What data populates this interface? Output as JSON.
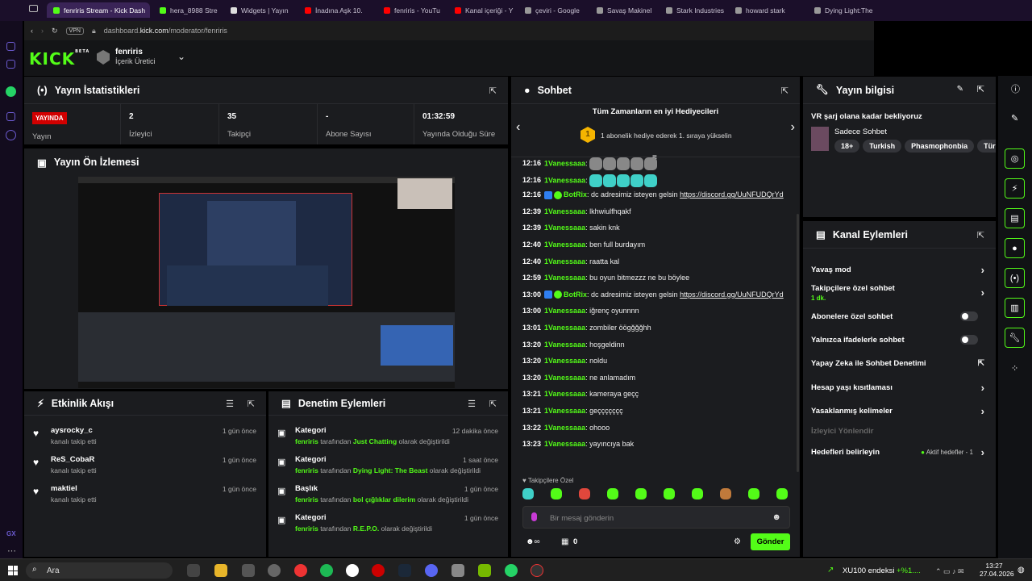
{
  "browser": {
    "tabs": [
      {
        "label": "fenriris Stream - Kick Dash",
        "color": "#53fc18",
        "active": true
      },
      {
        "label": "hera_8988 Stre",
        "color": "#53fc18"
      },
      {
        "label": "Widgets | Yayın",
        "color": "#dddddd"
      },
      {
        "label": "İnadına Aşk 10.",
        "color": "#ff0000"
      },
      {
        "label": "fenriris - YouTu",
        "color": "#ff0000"
      },
      {
        "label": "Kanal içeriği - Y",
        "color": "#ff0000"
      },
      {
        "label": "çeviri - Google",
        "color": "#999999"
      },
      {
        "label": "Savaş Makinel",
        "color": "#999999"
      },
      {
        "label": "Stark Industries",
        "color": "#999999"
      },
      {
        "label": "howard stark",
        "color": "#999999"
      },
      {
        "label": "Dying Light:The",
        "color": "#999999"
      }
    ],
    "vpn_label": "VPN",
    "url_prefix": "dashboard.",
    "url_domain": "kick.com",
    "url_path": "/moderator/fenriris"
  },
  "header": {
    "logo": "KICK",
    "logo_badge": "BETA",
    "channel_name": "fenriris",
    "channel_role": "İçerik Üretici"
  },
  "stats": {
    "title": "Yayın İstatistikleri",
    "live_badge": "YAYINDA",
    "items": [
      {
        "value": "",
        "label": "Yayın"
      },
      {
        "value": "2",
        "label": "İzleyici"
      },
      {
        "value": "35",
        "label": "Takipçi"
      },
      {
        "value": "-",
        "label": "Abone Sayısı"
      },
      {
        "value": "01:32:59",
        "label": "Yayında Olduğu Süre"
      }
    ]
  },
  "preview": {
    "title": "Yayın Ön İzlemesi"
  },
  "activity": {
    "title": "Etkinlik Akışı",
    "items": [
      {
        "user": "aysrocky_c",
        "action": "kanalı takip etti",
        "time": "1 gün önce"
      },
      {
        "user": "ReS_CobaR",
        "action": "kanalı takip etti",
        "time": "1 gün önce"
      },
      {
        "user": "maktiel",
        "action": "kanalı takip etti",
        "time": "1 gün önce"
      }
    ]
  },
  "moderation": {
    "title": "Denetim Eylemleri",
    "items": [
      {
        "type": "Kategori",
        "user": "fenriris",
        "mid": " tarafından ",
        "value": "Just Chatting",
        "end": " olarak değiştirildi",
        "time": "12 dakika önce"
      },
      {
        "type": "Kategori",
        "user": "fenriris",
        "mid": " tarafından ",
        "value": "Dying Light: The Beast",
        "end": " olarak değiştirildi",
        "time": "1 saat önce"
      },
      {
        "type": "Başlık",
        "user": "fenriris",
        "mid": " tarafından ",
        "value": "bol çığlıklar dilerim",
        "end": " olarak değiştirildi",
        "time": "1 gün önce"
      },
      {
        "type": "Kategori",
        "user": "fenriris",
        "mid": " tarafından ",
        "value": "R.E.P.O.",
        "end": " olarak değiştirildi",
        "time": "1 gün önce"
      }
    ]
  },
  "chat": {
    "title": "Sohbet",
    "gifters_title": "Tüm Zamanların en iyi Hediyecileri",
    "gifters_rank": "1",
    "gifters_sub": "1 abonelik hediye ederek 1. sıraya yükselin",
    "messages": [
      {
        "time": "12:16",
        "user": "1Vanessaaa",
        "text": "",
        "emotes": "ggggg"
      },
      {
        "time": "12:16",
        "user": "1Vanessaaa",
        "text": "",
        "emotes": "ccccc"
      },
      {
        "time": "12:16",
        "user": "BotRix",
        "text": "dc adresimiz isteyen gelsin ",
        "link": "https://discord.gg/UuNFUDQrYd",
        "bot": true
      },
      {
        "time": "12:39",
        "user": "1Vanessaaa",
        "text": "lkhwiulfhqakf"
      },
      {
        "time": "12:39",
        "user": "1Vanessaaa",
        "text": "sakin knk"
      },
      {
        "time": "12:40",
        "user": "1Vanessaaa",
        "text": "ben full burdayım"
      },
      {
        "time": "12:40",
        "user": "1Vanessaaa",
        "text": "raatta kal"
      },
      {
        "time": "12:59",
        "user": "1Vanessaaa",
        "text": "bu oyun bitmezzz ne bu böylee"
      },
      {
        "time": "13:00",
        "user": "BotRix",
        "text": "dc adresimiz isteyen gelsin ",
        "link": "https://discord.gg/UuNFUDQrYd",
        "bot": true
      },
      {
        "time": "13:00",
        "user": "1Vanessaaa",
        "text": "iğrenç oyunnnn"
      },
      {
        "time": "13:01",
        "user": "1Vanessaaa",
        "text": "zombiler öögğğğhh"
      },
      {
        "time": "13:20",
        "user": "1Vanessaaa",
        "text": "hoşgeldinn"
      },
      {
        "time": "13:20",
        "user": "1Vanessaaa",
        "text": "noldu"
      },
      {
        "time": "13:20",
        "user": "1Vanessaaa",
        "text": "ne anlamadım"
      },
      {
        "time": "13:21",
        "user": "1Vanessaaa",
        "text": "kameraya geçç"
      },
      {
        "time": "13:21",
        "user": "1Vanessaaa",
        "text": "geççççççç"
      },
      {
        "time": "13:22",
        "user": "1Vanessaaa",
        "text": "ohooo"
      },
      {
        "time": "13:23",
        "user": "1Vanessaaa",
        "text": "yayıncıya bak"
      }
    ],
    "followers_only_label": "Takipçilere Özel",
    "input_placeholder": "Bir mesaj gönderin",
    "counter_value": "0",
    "send_label": "Gönder",
    "emote_colors": [
      "#3fd0c8",
      "#53fc18",
      "#e0473c",
      "#53fc18",
      "#53fc18",
      "#53fc18",
      "#53fc18",
      "#c07a3b",
      "#53fc18",
      "#53fc18"
    ]
  },
  "stream_info": {
    "title": "Yayın bilgisi",
    "stream_title": "VR şarj olana kadar bekliyoruz",
    "category": "Sadece Sohbet",
    "tags": [
      "18+",
      "Turkish",
      "Phasmophonbia",
      "Türk"
    ]
  },
  "channel_actions": {
    "title": "Kanal Eylemleri",
    "items": [
      {
        "label": "Yavaş mod",
        "control": "chevron"
      },
      {
        "label": "Takipçilere özel sohbet",
        "sub": "1 dk.",
        "control": "chevron"
      },
      {
        "label": "Abonelere özel sohbet",
        "control": "toggle"
      },
      {
        "label": "Yalnızca ifadelerle sohbet",
        "control": "toggle"
      },
      {
        "label": "Yapay Zeka ile Sohbet Denetimi",
        "control": "external"
      },
      {
        "label": "Hesap yaşı kısıtlaması",
        "control": "chevron"
      },
      {
        "label": "Yasaklanmış kelimeler",
        "control": "chevron"
      },
      {
        "label": "İzleyici Yönlendir",
        "control": "disabled"
      },
      {
        "label": "Hedefleri belirleyin",
        "control": "chevron",
        "status": "Aktif hedefler - 1"
      }
    ]
  },
  "taskbar": {
    "search_placeholder": "Ara",
    "market_label": "XU100 endeksi",
    "market_change": "+%1....",
    "time": "13:27",
    "date": "27.04.2026"
  }
}
